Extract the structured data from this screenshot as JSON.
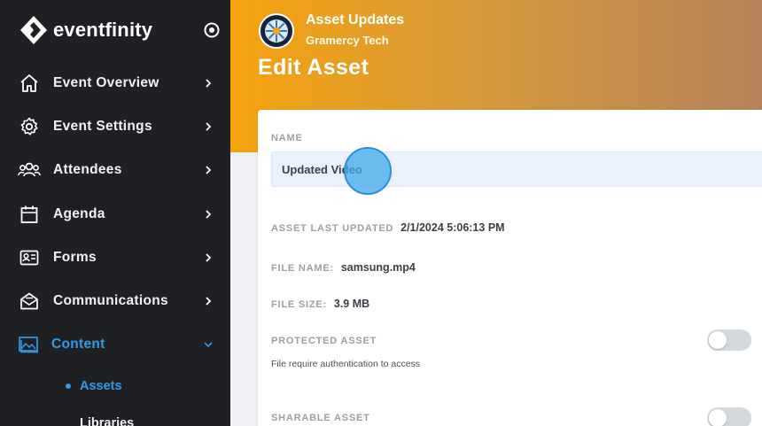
{
  "brand": {
    "name": "eventfinity"
  },
  "sidebar": {
    "items": [
      {
        "label": "Event Overview",
        "icon": "home-icon"
      },
      {
        "label": "Event Settings",
        "icon": "gear-icon"
      },
      {
        "label": "Attendees",
        "icon": "people-icon"
      },
      {
        "label": "Agenda",
        "icon": "calendar-icon"
      },
      {
        "label": "Forms",
        "icon": "id-card-icon"
      },
      {
        "label": "Communications",
        "icon": "envelope-icon"
      },
      {
        "label": "Content",
        "icon": "image-icon",
        "active": true
      }
    ],
    "sub_items": [
      {
        "label": "Assets",
        "active": true
      },
      {
        "label": "Libraries",
        "active": false
      }
    ]
  },
  "header": {
    "org_title": "Asset Updates",
    "org_subtitle": "Gramercy Tech",
    "page_title": "Edit Asset"
  },
  "form": {
    "name_label": "NAME",
    "name_value": "Updated Video",
    "last_updated_label": "ASSET LAST UPDATED",
    "last_updated_value": "2/1/2024 5:06:13 PM",
    "file_name_label": "FILE NAME:",
    "file_name_value": "samsung.mp4",
    "file_size_label": "FILE SIZE:",
    "file_size_value": "3.9 MB",
    "protected_label": "PROTECTED ASSET",
    "protected_helper": "File require authentication to access",
    "protected_on": false,
    "sharable_label": "SHARABLE ASSET",
    "sharable_on": false
  },
  "colors": {
    "accent": "#2f9be8",
    "sidebar_bg": "#1f2023",
    "header_start": "#f5a30d",
    "header_end": "#b4835a"
  }
}
